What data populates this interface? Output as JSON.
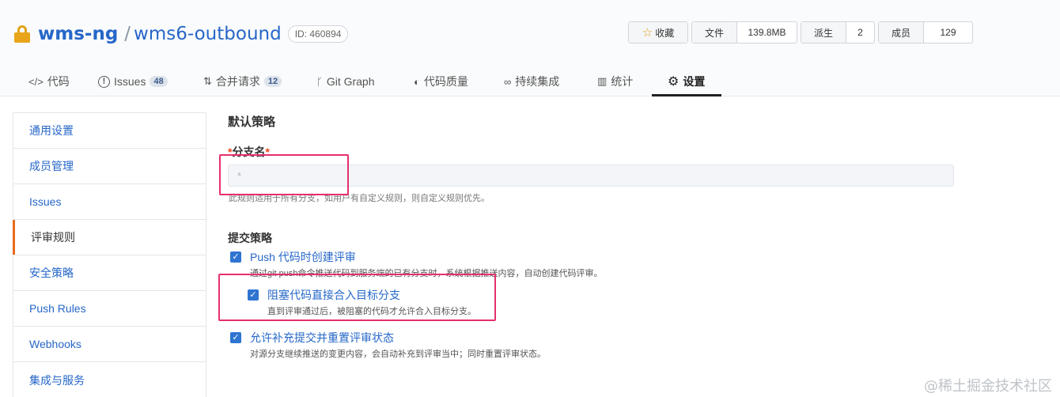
{
  "repo": {
    "owner": "wms-ng",
    "slash": "/",
    "name": "wms6-outbound",
    "id": "ID: 460894"
  },
  "stats": {
    "star_label": "收藏",
    "files_label": "文件",
    "files_value": "139.8MB",
    "forks_label": "派生",
    "forks_value": "2",
    "members_label": "成员",
    "members_value": "129"
  },
  "tabs": [
    {
      "icon": "</>",
      "label": "代码"
    },
    {
      "icon": "!",
      "label": "Issues",
      "badge": "48"
    },
    {
      "icon": "⇅",
      "label": "合并请求",
      "badge": "12"
    },
    {
      "icon": "ᚴ",
      "label": "Git Graph"
    },
    {
      "icon": "◐",
      "label": "代码质量"
    },
    {
      "icon": "∞",
      "label": "持续集成"
    },
    {
      "icon": "▥",
      "label": "统计"
    },
    {
      "icon": "⚙",
      "label": "设置"
    }
  ],
  "sidebar": {
    "items": [
      {
        "label": "通用设置"
      },
      {
        "label": "成员管理"
      },
      {
        "label": "Issues"
      },
      {
        "label": "评审规则"
      },
      {
        "label": "安全策略"
      },
      {
        "label": "Push Rules"
      },
      {
        "label": "Webhooks"
      },
      {
        "label": "集成与服务"
      }
    ]
  },
  "main": {
    "section_title": "默认策略",
    "branch_label": "分支名",
    "required_mark": "*",
    "branch_placeholder": "*",
    "branch_help": "此规则适用于所有分支，如用户有自定义规则，则自定义规则优先。",
    "submit_title": "提交策略",
    "options": [
      {
        "label": "Push 代码时创建评审",
        "desc": "通过git push命令推送代码到服务端的已有分支时，系统根据推送内容，自动创建代码评审。",
        "checked": true
      },
      {
        "label": "阻塞代码直接合入目标分支",
        "desc": "直到评审通过后，被阻塞的代码才允许合入目标分支。",
        "checked": true
      },
      {
        "label": "允许补充提交并重置评审状态",
        "desc": "对源分支继续推送的变更内容，会自动补充到评审当中；同时重置评审状态。",
        "checked": true
      }
    ]
  },
  "watermark": "@稀土掘金技术社区",
  "colors": {
    "link": "#2667c8",
    "highlight": "#e62f6e",
    "active_marker": "#e86b1c",
    "checkbox": "#2f74d0"
  }
}
